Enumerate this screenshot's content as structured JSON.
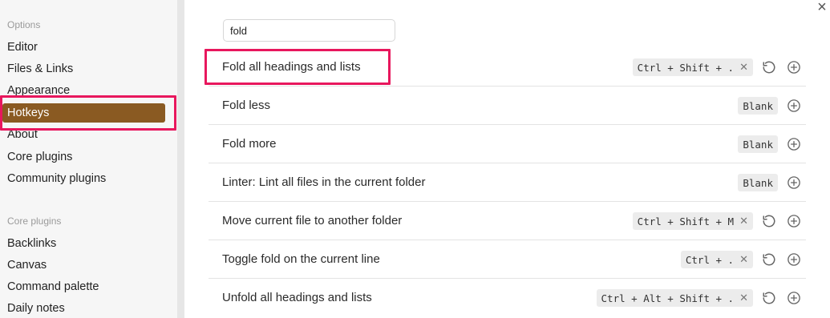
{
  "sidebar": {
    "options_title": "Options",
    "options_items": [
      "Editor",
      "Files & Links",
      "Appearance",
      "Hotkeys",
      "About",
      "Core plugins",
      "Community plugins"
    ],
    "core_plugins_title": "Core plugins",
    "core_plugins_items": [
      "Backlinks",
      "Canvas",
      "Command palette",
      "Daily notes"
    ],
    "active_item": "Hotkeys"
  },
  "search": {
    "value": "fold"
  },
  "close_label": "×",
  "hotkeys": [
    {
      "name": "Fold all headings and lists",
      "hotkey": "Ctrl + Shift + .",
      "blank": false,
      "reset": true
    },
    {
      "name": "Fold less",
      "hotkey": "Blank",
      "blank": true,
      "reset": false
    },
    {
      "name": "Fold more",
      "hotkey": "Blank",
      "blank": true,
      "reset": false
    },
    {
      "name": "Linter: Lint all files in the current folder",
      "hotkey": "Blank",
      "blank": true,
      "reset": false
    },
    {
      "name": "Move current file to another folder",
      "hotkey": "Ctrl + Shift + M",
      "blank": false,
      "reset": true
    },
    {
      "name": "Toggle fold on the current line",
      "hotkey": "Ctrl + .",
      "blank": false,
      "reset": true
    },
    {
      "name": "Unfold all headings and lists",
      "hotkey": "Ctrl + Alt + Shift + .",
      "blank": false,
      "reset": true
    }
  ],
  "colors": {
    "active_bg": "#8a5a22",
    "highlight": "#e8175d",
    "sidebar_bg": "#f6f6f6"
  }
}
